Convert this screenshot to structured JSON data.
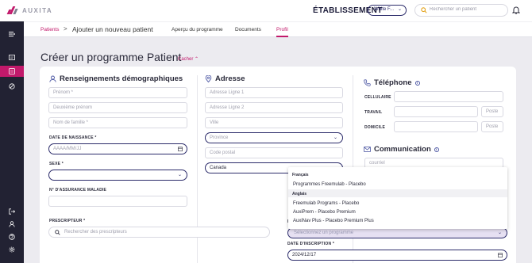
{
  "header": {
    "logo_text": "AUXITA",
    "establishment": "ÉTABLISSEMENT",
    "site_select": "White F...",
    "search_placeholder": "Rechercher un patient"
  },
  "breadcrumb": {
    "link": "Patients",
    "separator": ">",
    "current": "Ajouter un nouveau patient"
  },
  "tabs": [
    {
      "label": "Aperçu du programme",
      "active": false
    },
    {
      "label": "Documents",
      "active": false
    },
    {
      "label": "Profil",
      "active": true
    }
  ],
  "page": {
    "title": "Créer un programme Patient",
    "hide_link": "Cacher ⌃"
  },
  "demographics": {
    "title": "Renseignements démographiques",
    "first_name_placeholder": "Prénom *",
    "middle_name_placeholder": "Deuxième prénom",
    "last_name_placeholder": "Nom de famille *",
    "dob_label": "DATE DE NAISSANCE *",
    "dob_placeholder": "AAAA/MM/JJ",
    "sex_label": "SEXE *",
    "sex_value": "",
    "health_label": "N° D'ASSURANCE MALADIE",
    "health_value": "",
    "prescriber_label": "PRESCRIPTEUR *",
    "prescriber_placeholder": "Rechercher des prescripteurs"
  },
  "address": {
    "title": "Adresse",
    "line1_placeholder": "Adresse Ligne 1",
    "line2_placeholder": "Adresse Ligne 2",
    "city_placeholder": "Ville",
    "province_placeholder": "Province",
    "postal_placeholder": "Code postal",
    "country_value": "Canada"
  },
  "phone": {
    "title": "Téléphone",
    "cell_label": "CELLULAIRE",
    "work_label": "TRAVAIL",
    "home_label": "DOMICILE",
    "ext_placeholder": "Poste"
  },
  "communication": {
    "title": "Communication",
    "email_placeholder": "courriel"
  },
  "program_dropdown": {
    "groups": [
      {
        "label": "Français",
        "options": [
          "Programmes Freemulab - Placebo"
        ]
      },
      {
        "label": "Anglais",
        "options": [
          "Freemulab Programs - Placebo",
          "AuxiPrem - Placebo Premium",
          "AuxiNav Plus - Placebo Premium Plus"
        ]
      }
    ],
    "partial_label": "P",
    "select_placeholder": "Sélectionnez un programme",
    "enroll_label": "DATE D'INSCRIPTION *",
    "enroll_value": "2024/12/17"
  }
}
